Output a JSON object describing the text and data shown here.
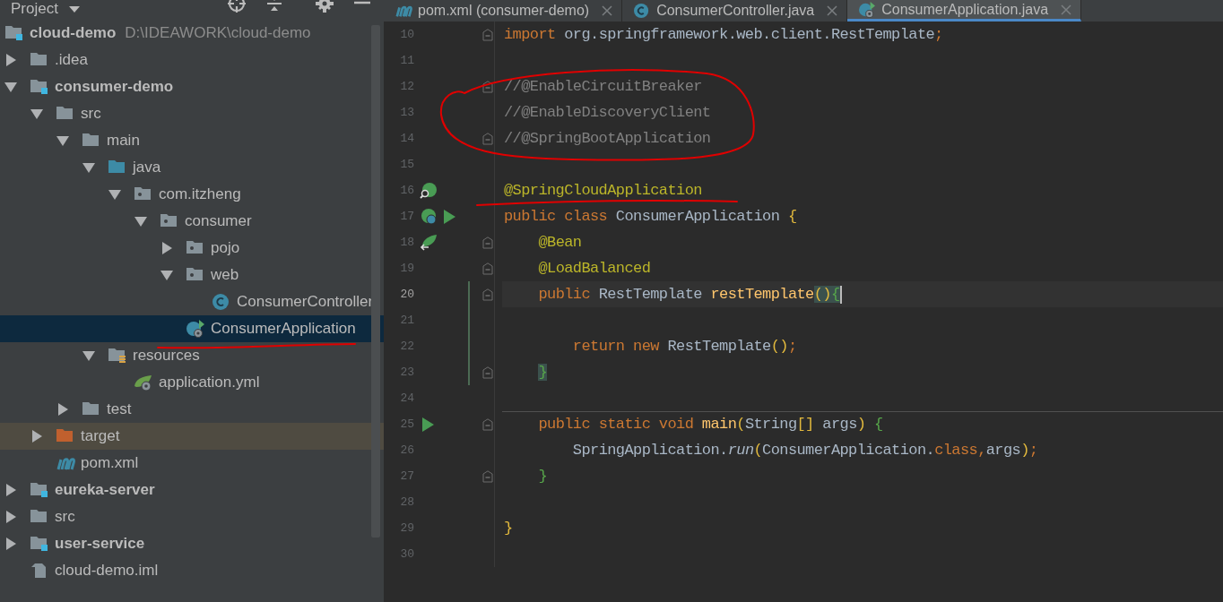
{
  "project": {
    "title": "Project",
    "tree": {
      "name": "cloud-demo",
      "path": "D:\\IDEAWORK\\cloud-demo",
      "kind": "module",
      "selected": false,
      "children": [
        {
          "name": ".idea",
          "kind": "folder",
          "expanded": false,
          "selected": false
        },
        {
          "name": "consumer-demo",
          "kind": "module",
          "expanded": true,
          "selected": false,
          "children": [
            {
              "name": "src",
              "kind": "folder",
              "expanded": true,
              "selected": false,
              "children": [
                {
                  "name": "main",
                  "kind": "folder",
                  "expanded": true,
                  "selected": false,
                  "children": [
                    {
                      "name": "java",
                      "kind": "source-root",
                      "expanded": true,
                      "selected": false,
                      "children": [
                        {
                          "name": "com.itzheng",
                          "kind": "package",
                          "expanded": true,
                          "selected": false,
                          "children": [
                            {
                              "name": "consumer",
                              "kind": "package",
                              "expanded": true,
                              "selected": false,
                              "children": [
                                {
                                  "name": "pojo",
                                  "kind": "package",
                                  "expanded": false,
                                  "selected": false
                                },
                                {
                                  "name": "web",
                                  "kind": "package",
                                  "expanded": true,
                                  "selected": false,
                                  "children": [
                                    {
                                      "name": "ConsumerController",
                                      "kind": "class",
                                      "selected": false
                                    }
                                  ]
                                },
                                {
                                  "name": "ConsumerApplication",
                                  "kind": "spring-class",
                                  "selected": true
                                }
                              ]
                            }
                          ]
                        }
                      ]
                    },
                    {
                      "name": "resources",
                      "kind": "resources",
                      "expanded": true,
                      "selected": false,
                      "children": [
                        {
                          "name": "application.yml",
                          "kind": "spring-config",
                          "selected": false
                        }
                      ]
                    }
                  ]
                },
                {
                  "name": "test",
                  "kind": "folder",
                  "expanded": false,
                  "selected": false
                }
              ]
            },
            {
              "name": "target",
              "kind": "excluded",
              "expanded": false,
              "selected": false
            },
            {
              "name": "pom.xml",
              "kind": "maven",
              "selected": false
            }
          ]
        },
        {
          "name": "eureka-server",
          "kind": "module",
          "expanded": false,
          "selected": false
        },
        {
          "name": "src",
          "kind": "folder",
          "expanded": false,
          "selected": false
        },
        {
          "name": "user-service",
          "kind": "module",
          "expanded": false,
          "selected": false
        },
        {
          "name": "cloud-demo.iml",
          "kind": "iml",
          "selected": false
        }
      ]
    }
  },
  "editor": {
    "tabs": [
      {
        "label": "pom.xml (consumer-demo)",
        "kind": "maven",
        "selected": false
      },
      {
        "label": "ConsumerController.java",
        "kind": "class",
        "selected": false
      },
      {
        "label": "ConsumerApplication.java",
        "kind": "spring-class",
        "selected": true
      }
    ],
    "lines": [
      {
        "number": "10",
        "fold": true,
        "current": false,
        "changed": false,
        "separator": false,
        "tokens": [
          {
            "text": "import",
            "kind": "keyword"
          },
          {
            "text": " org.springframework.web.client.RestTemplate",
            "kind": "plain"
          },
          {
            "text": ";",
            "kind": "keyword"
          }
        ]
      },
      {
        "number": "11",
        "fold": false,
        "current": false,
        "changed": false,
        "separator": false
      },
      {
        "number": "12",
        "fold": true,
        "current": false,
        "changed": false,
        "separator": false,
        "tokens": [
          {
            "text": "//@EnableCircuitBreaker",
            "kind": "comment"
          }
        ]
      },
      {
        "number": "13",
        "fold": false,
        "current": false,
        "changed": false,
        "separator": false,
        "tokens": [
          {
            "text": "//@EnableDiscoveryClient",
            "kind": "comment"
          }
        ]
      },
      {
        "number": "14",
        "fold": true,
        "current": false,
        "changed": false,
        "separator": false,
        "tokens": [
          {
            "text": "//@SpringBootApplication",
            "kind": "comment"
          }
        ]
      },
      {
        "number": "15",
        "fold": false,
        "current": false,
        "changed": false,
        "separator": false
      },
      {
        "number": "16",
        "fold": false,
        "current": false,
        "changed": false,
        "separator": false,
        "gutter": [
          {
            "kind": "spring-find"
          }
        ],
        "tokens": [
          {
            "text": "@SpringCloudApplication",
            "kind": "annotation"
          }
        ]
      },
      {
        "number": "17",
        "fold": false,
        "current": false,
        "changed": false,
        "separator": false,
        "gutter": [
          {
            "kind": "spring-class"
          },
          {
            "kind": "run"
          }
        ],
        "tokens": [
          {
            "text": "public class",
            "kind": "keyword"
          },
          {
            "text": " ConsumerApplication ",
            "kind": "plain"
          },
          {
            "text": "{",
            "kind": "bracket1"
          }
        ]
      },
      {
        "number": "18",
        "fold": true,
        "current": false,
        "changed": false,
        "separator": false,
        "gutter": [
          {
            "kind": "spring-bean"
          }
        ],
        "tokens": [
          {
            "text": "    @Bean",
            "kind": "annotation"
          }
        ]
      },
      {
        "number": "19",
        "fold": true,
        "current": false,
        "changed": false,
        "separator": false,
        "tokens": [
          {
            "text": "    @LoadBalanced",
            "kind": "annotation"
          }
        ]
      },
      {
        "number": "20",
        "fold": true,
        "current": true,
        "changed": true,
        "separator": false,
        "tokens": [
          {
            "text": "    public",
            "kind": "keyword"
          },
          {
            "text": " RestTemplate ",
            "kind": "plain"
          },
          {
            "text": "restTemplate",
            "kind": "method"
          },
          {
            "text": "()",
            "kind": "bracket1-match"
          },
          {
            "text": "{",
            "kind": "bracket2-match"
          }
        ]
      },
      {
        "number": "21",
        "fold": false,
        "current": false,
        "changed": true,
        "separator": false
      },
      {
        "number": "22",
        "fold": false,
        "current": false,
        "changed": true,
        "separator": false,
        "tokens": [
          {
            "text": "        return new",
            "kind": "keyword"
          },
          {
            "text": " RestTemplate",
            "kind": "plain"
          },
          {
            "text": "()",
            "kind": "bracket1"
          },
          {
            "text": ";",
            "kind": "keyword"
          }
        ]
      },
      {
        "number": "23",
        "fold": true,
        "current": false,
        "changed": true,
        "separator": false,
        "tokens": [
          {
            "text": "    }",
            "kind": "bracket2-match"
          }
        ]
      },
      {
        "number": "24",
        "fold": false,
        "current": false,
        "changed": false,
        "separator": false
      },
      {
        "number": "25",
        "fold": true,
        "current": false,
        "changed": false,
        "separator": true,
        "gutter": [
          {
            "kind": "run"
          }
        ],
        "tokens": [
          {
            "text": "    public static void ",
            "kind": "keyword"
          },
          {
            "text": "main",
            "kind": "method"
          },
          {
            "text": "(",
            "kind": "bracket1"
          },
          {
            "text": "String",
            "kind": "plain"
          },
          {
            "text": "[]",
            "kind": "bracket1"
          },
          {
            "text": " args",
            "kind": "plain"
          },
          {
            "text": ")",
            "kind": "bracket1"
          },
          {
            "text": " {",
            "kind": "bracket2"
          }
        ]
      },
      {
        "number": "26",
        "fold": false,
        "current": false,
        "changed": false,
        "separator": false,
        "tokens": [
          {
            "text": "        SpringApplication.",
            "kind": "plain"
          },
          {
            "text": "run",
            "kind": "static-call"
          },
          {
            "text": "(",
            "kind": "bracket1"
          },
          {
            "text": "ConsumerApplication.",
            "kind": "plain"
          },
          {
            "text": "class",
            "kind": "keyword"
          },
          {
            "text": ",",
            "kind": "keyword"
          },
          {
            "text": "args",
            "kind": "plain"
          },
          {
            "text": ")",
            "kind": "bracket1"
          },
          {
            "text": ";",
            "kind": "keyword"
          }
        ]
      },
      {
        "number": "27",
        "fold": true,
        "current": false,
        "changed": false,
        "separator": false,
        "tokens": [
          {
            "text": "    }",
            "kind": "bracket2"
          }
        ]
      },
      {
        "number": "28",
        "fold": false,
        "current": false,
        "changed": false,
        "separator": false
      },
      {
        "number": "29",
        "fold": false,
        "current": false,
        "changed": false,
        "separator": false,
        "tokens": [
          {
            "text": "}",
            "kind": "bracket1"
          }
        ]
      },
      {
        "number": "30",
        "fold": false,
        "current": false,
        "changed": false,
        "separator": false
      }
    ]
  }
}
